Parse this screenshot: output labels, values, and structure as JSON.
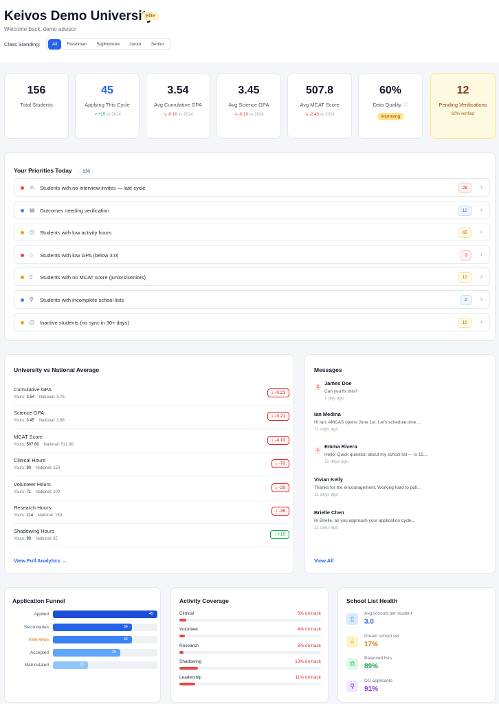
{
  "header": {
    "title": "Keivos Demo University",
    "badge": "Elite",
    "welcome": "Welcome back, demo advisor",
    "class_label": "Class Standing:"
  },
  "filters": [
    "All",
    "Freshman",
    "Sophomore",
    "Junior",
    "Senior"
  ],
  "stats": [
    {
      "value": "156",
      "label": "Total Students",
      "trend": ""
    },
    {
      "value": "45",
      "label": "Applying This Cycle",
      "trend_arrow": "↗",
      "trend_val": "+15",
      "trend_suffix": "vs 2024"
    },
    {
      "value": "3.54",
      "label": "Avg Cumulative GPA",
      "trend_arrow": "↘",
      "trend_val": "-0.10",
      "trend_suffix": "vs 2024"
    },
    {
      "value": "3.45",
      "label": "Avg Science GPA",
      "trend_arrow": "↘",
      "trend_val": "-0.10",
      "trend_suffix": "vs 2024"
    },
    {
      "value": "507.8",
      "label": "Avg MCAT Score",
      "trend_arrow": "↘",
      "trend_val": "-2.43",
      "trend_suffix": "vs 2024"
    },
    {
      "value": "60%",
      "label": "Data Quality",
      "pill": "Improving"
    },
    {
      "value": "12",
      "label": "Pending Verifications",
      "sub": "60% verified"
    }
  ],
  "priorities": {
    "title": "Your Priorities Today",
    "count": "130",
    "items": [
      {
        "label": "Students with no interview invites — late cycle",
        "count": "28",
        "dot": "#ef4444",
        "icon": "⚠",
        "bold": true,
        "tone": "red"
      },
      {
        "label": "Outcomes needing verification",
        "count": "12",
        "dot": "#3b82f6",
        "icon": "▤",
        "bold": true,
        "tone": "blue"
      },
      {
        "label": "Students with low activity hours",
        "count": "65",
        "dot": "#f59e0b",
        "icon": "◷",
        "bold": true,
        "tone": "amber"
      },
      {
        "label": "Students with low GPA (below 3.0)",
        "count": "3",
        "dot": "#ef4444",
        "icon": "⌂",
        "bold": true,
        "tone": "red"
      },
      {
        "label": "Students with no MCAT score (juniors/seniors)",
        "count": "10",
        "dot": "#f59e0b",
        "icon": "▯",
        "bold": true,
        "tone": "amber"
      },
      {
        "label": "Students with incomplete school lists",
        "count": "2",
        "dot": "#3b82f6",
        "icon": "⚲",
        "bold": true,
        "tone": "blue"
      },
      {
        "label": "Inactive students (no sync in 30+ days)",
        "count": "10",
        "dot": "#f59e0b",
        "icon": "◷",
        "bold": true,
        "tone": "amber"
      }
    ]
  },
  "comparison": {
    "title": "University vs National Average",
    "yours_label": "Yours:",
    "national_label": "National:",
    "link": "View Full Analytics →",
    "rows": [
      {
        "name": "Cumulative GPA",
        "yours": "3.54",
        "national": "3.75",
        "delta": "↓ -0.21",
        "neg": true
      },
      {
        "name": "Science GPA",
        "yours": "3.45",
        "national": "3.66",
        "delta": "↓ -0.21",
        "neg": true
      },
      {
        "name": "MCAT Score",
        "yours": "507.80",
        "national": "511.90",
        "delta": "↓ -4.10",
        "neg": true
      },
      {
        "name": "Clinical Hours",
        "yours": "80",
        "national": "150",
        "delta": "↓ -70",
        "neg": true
      },
      {
        "name": "Volunteer Hours",
        "yours": "71",
        "national": "100",
        "delta": "↓ -29",
        "neg": true
      },
      {
        "name": "Research Hours",
        "yours": "114",
        "national": "150",
        "delta": "↓ -36",
        "neg": true
      },
      {
        "name": "Shadowing Hours",
        "yours": "80",
        "national": "65",
        "delta": "↑ +15",
        "neg": false
      }
    ]
  },
  "messages": {
    "title": "Messages",
    "link": "View All",
    "items": [
      {
        "name": "James Doe",
        "text": "Can you fix this?",
        "time": "1 day ago",
        "unread": "2"
      },
      {
        "name": "Ian Medina",
        "text": "Hi Ian, AMCAS opens June 1st. Let's schedule time ...",
        "time": "11 days ago",
        "unread": ""
      },
      {
        "name": "Emma Rivera",
        "text": "Hello! Quick question about my school list — is 15...",
        "time": "11 days ago",
        "unread": "1"
      },
      {
        "name": "Vivian Kelly",
        "text": "Thanks for the encouragement. Working hard to pull...",
        "time": "11 days ago",
        "unread": ""
      },
      {
        "name": "Brielle Chen",
        "text": "Hi Brielle, as you approach your application cycle...",
        "time": "11 days ago",
        "unread": ""
      }
    ]
  },
  "funnel": {
    "title": "Application Funnel",
    "stages": [
      {
        "label": "Applied",
        "value": 45,
        "color": "#1d4ed8",
        "label_color": "#4b5563"
      },
      {
        "label": "Secondaries",
        "value": 34,
        "color": "#2563eb",
        "label_color": "#4b5563"
      },
      {
        "label": "Interviews",
        "value": 34,
        "color": "#3b82f6",
        "label_color": "#d97706"
      },
      {
        "label": "Accepted",
        "value": 29,
        "color": "#60a5fa",
        "label_color": "#4b5563"
      },
      {
        "label": "Matriculated",
        "value": 15,
        "color": "#93c5fd",
        "label_color": "#4b5563"
      }
    ]
  },
  "activity": {
    "title": "Activity Coverage",
    "rows": [
      {
        "name": "Clinical",
        "pct": 5,
        "text": "5% on track"
      },
      {
        "name": "Volunteer",
        "pct": 4,
        "text": "4% on track"
      },
      {
        "name": "Research",
        "pct": 3,
        "text": "3% on track"
      },
      {
        "name": "Shadowing",
        "pct": 13,
        "text": "13% on track"
      },
      {
        "name": "Leadership",
        "pct": 11,
        "text": "11% on track"
      }
    ]
  },
  "health": {
    "title": "School List Health",
    "rows": [
      {
        "label": "Avg schools per student",
        "value": "3.0",
        "icon": "▯",
        "color": "#2563eb",
        "bg": "#dbeafe"
      },
      {
        "label": "Dream school set",
        "value": "17%",
        "icon": "☆",
        "color": "#d97706",
        "bg": "#fef3c7"
      },
      {
        "label": "Balanced lists",
        "value": "89%",
        "icon": "⚖",
        "color": "#16a34a",
        "bg": "#dcfce7"
      },
      {
        "label": "DO applicants",
        "value": "91%",
        "icon": "⚲",
        "color": "#9333ea",
        "bg": "#f3e8ff"
      }
    ]
  }
}
